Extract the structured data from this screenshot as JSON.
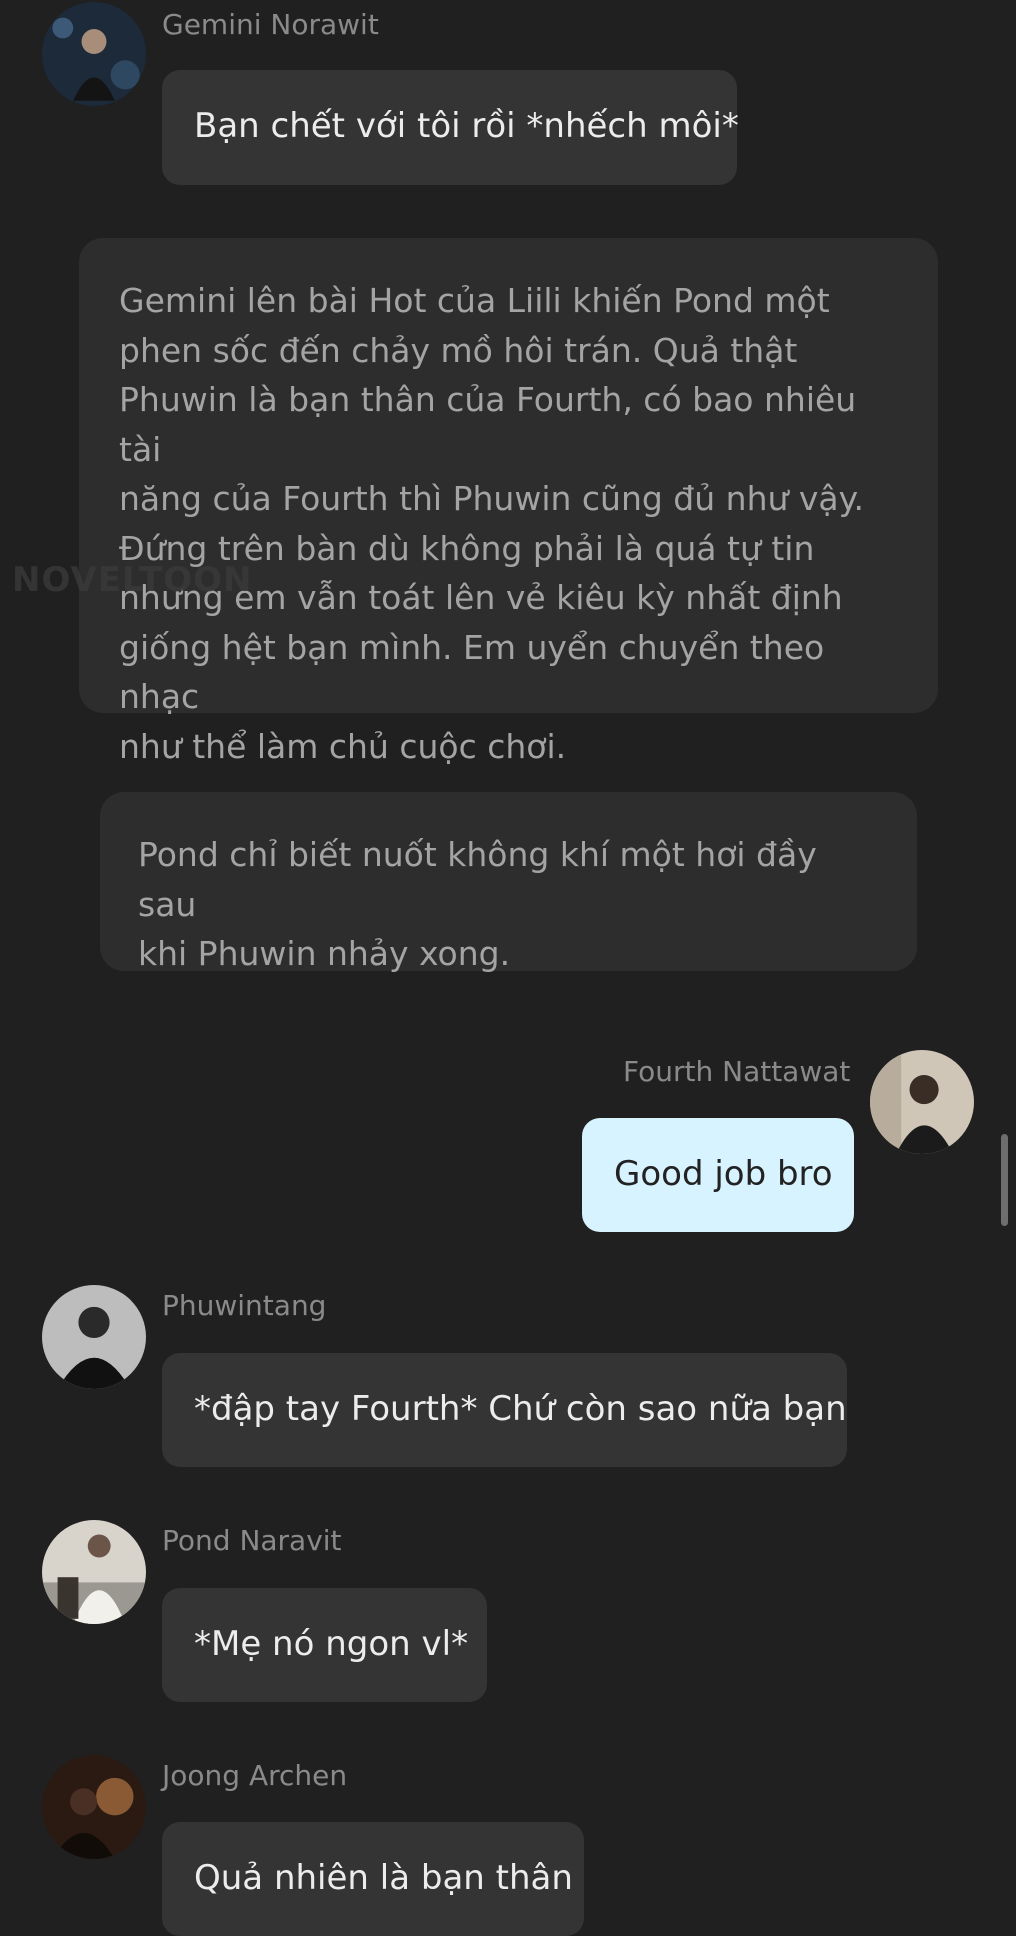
{
  "messages": [
    {
      "sender": "Gemini Norawit",
      "text": "Bạn chết với tôi rồi *nhếch môi*",
      "side": "left",
      "avatar_icon": "gemini-avatar"
    },
    {
      "sender": "Fourth Nattawat",
      "text": "Good job bro",
      "side": "right",
      "avatar_icon": "fourth-avatar"
    },
    {
      "sender": "Phuwintang",
      "text": "*đập tay Fourth* Chứ còn sao nữa bạn",
      "side": "left",
      "avatar_icon": "phuwin-avatar"
    },
    {
      "sender": "Pond Naravit",
      "text": "*Mẹ nó ngon vl*",
      "side": "left",
      "avatar_icon": "pond-avatar"
    },
    {
      "sender": "Joong Archen",
      "text": "Quả nhiên là bạn thân",
      "side": "left",
      "avatar_icon": "joong-avatar"
    }
  ],
  "narrations": [
    "Gemini lên bài Hot của Liili khiến Pond một\nphen sốc đến chảy mồ hôi trán. Quả thật\nPhuwin là bạn thân của Fourth, có bao nhiêu tài\nnăng của Fourth thì Phuwin cũng đủ như vậy.\nĐứng trên bàn dù không phải là quá tự tin\nnhưng em vẫn toát lên vẻ kiêu kỳ nhất định\ngiống hệt bạn mình. Em uyển chuyển theo nhạc\nnhư thể làm chủ cuộc chơi.",
    "Pond chỉ biết nuốt không khí một hơi đầy sau\nkhi Phuwin nhảy xong."
  ],
  "watermark": "NOVELTOON",
  "colors": {
    "background": "#202020",
    "bubble": "#343434",
    "bubble_self": "#d7f3ff",
    "narration": "#2d2d2d"
  }
}
